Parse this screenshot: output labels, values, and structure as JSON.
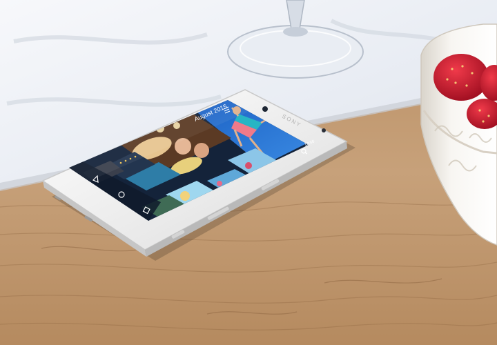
{
  "scene": {
    "description_free": true
  },
  "phone": {
    "brand": "SONY",
    "gallery": {
      "header_date": "August 2015",
      "status_time": "10:58"
    },
    "icons": {
      "menu": "menu-icon",
      "search": "search-icon",
      "back": "back-icon",
      "home": "home-icon",
      "recents": "recents-icon"
    }
  },
  "colors": {
    "tablecloth": "#eef1f6",
    "wood": "#c49a6c",
    "wood_dark": "#8b6440",
    "phone_body": "#f4f4f4",
    "screen_dark": "#1b2b44",
    "sky": "#1f6fd1",
    "strawberry": "#c8132a",
    "bowl": "#f5f2ec"
  }
}
